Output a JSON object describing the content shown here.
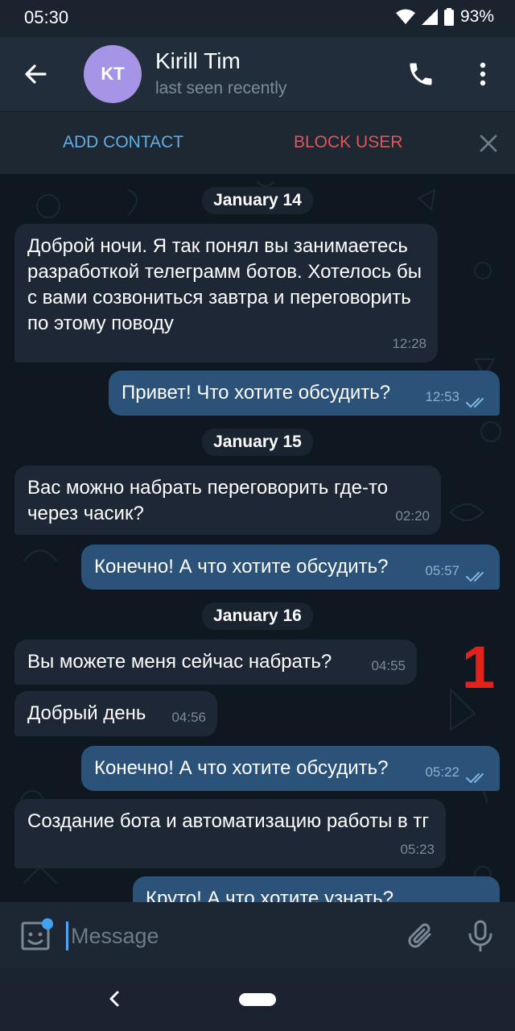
{
  "status_bar": {
    "time": "05:30",
    "battery": "93%"
  },
  "header": {
    "avatar_initials": "KT",
    "name": "Kirill Tim",
    "status": "last seen recently"
  },
  "action_bar": {
    "add_contact": "ADD CONTACT",
    "block_user": "BLOCK USER"
  },
  "messages": [
    {
      "type": "date",
      "text": "January 14"
    },
    {
      "type": "incoming",
      "text": "Доброй ночи. Я так понял вы занимаетесь разработкой телеграмм ботов. Хотелось бы с вами созвониться завтра и переговорить по этому поводу",
      "time": "12:28"
    },
    {
      "type": "outgoing",
      "text": "Привет! Что хотите обсудить?",
      "time": "12:53",
      "read": true
    },
    {
      "type": "date",
      "text": "January 15"
    },
    {
      "type": "incoming",
      "text": "Вас можно набрать переговорить где-то через часик?",
      "time": "02:20"
    },
    {
      "type": "outgoing",
      "text": "Конечно! А что хотите обсудить?",
      "time": "05:57",
      "read": true
    },
    {
      "type": "date",
      "text": "January 16"
    },
    {
      "type": "incoming",
      "text": "Вы можете меня сейчас набрать?",
      "time": "04:55"
    },
    {
      "type": "incoming",
      "text": "Добрый день",
      "time": "04:56"
    },
    {
      "type": "outgoing",
      "text": "Конечно! А что хотите обсудить?",
      "time": "05:22",
      "read": true
    },
    {
      "type": "incoming",
      "text": "Создание бота и автоматизацию работы в тг",
      "time": "05:23"
    },
    {
      "type": "outgoing",
      "text": "Круто! А что хотите узнать?",
      "time": "",
      "read": false
    }
  ],
  "annotation": "1",
  "input": {
    "placeholder": "Message"
  },
  "colors": {
    "accent": "#5eaee8",
    "danger": "#e0565b",
    "outgoing_bubble": "#2b5278",
    "incoming_bubble": "#1d2735"
  },
  "icons": [
    "back-arrow-icon",
    "phone-icon",
    "more-vert-icon",
    "close-icon",
    "sticker-icon",
    "attach-icon",
    "mic-icon",
    "wifi-icon",
    "signal-icon",
    "battery-icon",
    "read-ticks-icon"
  ]
}
